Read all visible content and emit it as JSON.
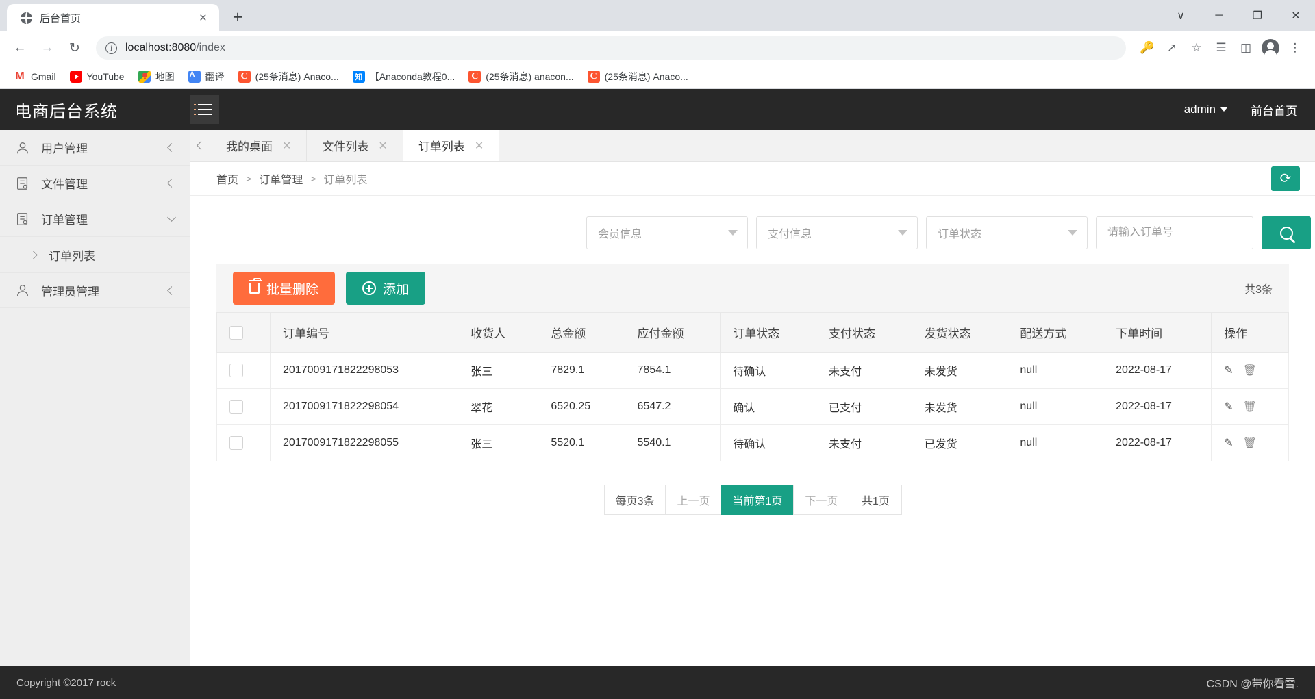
{
  "browser": {
    "tab": {
      "title": "后台首页",
      "favicon": "globe-icon",
      "close": "×"
    },
    "new_tab": "+",
    "window_controls": {
      "minimize_more": "∨",
      "minimize": "─",
      "maximize": "❐",
      "close": "✕"
    },
    "nav": {
      "back": "←",
      "forward": "→",
      "reload": "↻"
    },
    "omnibox": {
      "info_icon": "info-icon",
      "host": "localhost:8080",
      "path": "/index"
    },
    "toolbar_icons": [
      "key-icon",
      "share-icon",
      "star-icon",
      "reading-list-icon",
      "side-panel-icon",
      "profile-icon",
      "menu-icon"
    ],
    "bookmarks": [
      {
        "icon": "gmail-icon",
        "label": "Gmail"
      },
      {
        "icon": "youtube-icon",
        "label": "YouTube"
      },
      {
        "icon": "maps-icon",
        "label": "地图"
      },
      {
        "icon": "translate-icon",
        "label": "翻译"
      },
      {
        "icon": "csdn-icon",
        "label": "(25条消息) Anaco..."
      },
      {
        "icon": "zhihu-icon",
        "label": "【Anaconda教程0..."
      },
      {
        "icon": "csdn-icon",
        "label": "(25条消息) anacon..."
      },
      {
        "icon": "csdn-icon",
        "label": "(25条消息) Anaco..."
      }
    ]
  },
  "app": {
    "logo": "电商后台系统",
    "hamburger": "menu-toggle",
    "user": "admin",
    "front_link": "前台首页",
    "footer": "Copyright ©2017 rock",
    "watermark": "CSDN @带你看雪.",
    "accent": "#18a085",
    "danger": "#ff6c3c",
    "header_bg": "#282828"
  },
  "sidebar": {
    "items": [
      {
        "icon": "user-icon",
        "label": "用户管理",
        "chevron": "left"
      },
      {
        "icon": "file-icon",
        "label": "文件管理",
        "chevron": "left"
      },
      {
        "icon": "file-icon",
        "label": "订单管理",
        "chevron": "down"
      },
      {
        "icon": "user-icon",
        "label": "管理员管理",
        "chevron": "left"
      }
    ],
    "sub_item": {
      "label": "订单列表",
      "chevron": "right"
    }
  },
  "tabs": [
    {
      "label": "我的桌面",
      "active": false
    },
    {
      "label": "文件列表",
      "active": false
    },
    {
      "label": "订单列表",
      "active": true
    }
  ],
  "breadcrumb": {
    "items": [
      "首页",
      "订单管理",
      "订单列表"
    ],
    "separator": ">",
    "refresh": "refresh-icon"
  },
  "filters": {
    "selects": [
      {
        "name": "member-info",
        "value": "会员信息"
      },
      {
        "name": "payment-info",
        "value": "支付信息"
      },
      {
        "name": "order-status",
        "value": "订单状态"
      }
    ],
    "search": {
      "placeholder": "请输入订单号",
      "value": "",
      "button": "search-icon"
    }
  },
  "toolbar": {
    "delete_label": "批量删除",
    "add_label": "添加",
    "total": "共3条"
  },
  "table": {
    "columns": [
      "订单编号",
      "收货人",
      "总金额",
      "应付金额",
      "订单状态",
      "支付状态",
      "发货状态",
      "配送方式",
      "下单时间",
      "操作"
    ],
    "rows": [
      {
        "order_no": "2017009171822298053",
        "receiver": "张三",
        "total": "7829.1",
        "payable": "7854.1",
        "order_status": "待确认",
        "pay_status": "未支付",
        "ship_status": "未发货",
        "delivery": "null",
        "created": "2022-08-17"
      },
      {
        "order_no": "2017009171822298054",
        "receiver": "翠花",
        "total": "6520.25",
        "payable": "6547.2",
        "order_status": "确认",
        "pay_status": "已支付",
        "ship_status": "未发货",
        "delivery": "null",
        "created": "2022-08-17"
      },
      {
        "order_no": "2017009171822298055",
        "receiver": "张三",
        "total": "5520.1",
        "payable": "5540.1",
        "order_status": "待确认",
        "pay_status": "未支付",
        "ship_status": "已发货",
        "delivery": "null",
        "created": "2022-08-17"
      }
    ]
  },
  "pagination": [
    {
      "label": "每页3条",
      "state": "normal"
    },
    {
      "label": "上一页",
      "state": "muted"
    },
    {
      "label": "当前第1页",
      "state": "active"
    },
    {
      "label": "下一页",
      "state": "muted"
    },
    {
      "label": "共1页",
      "state": "normal"
    }
  ]
}
